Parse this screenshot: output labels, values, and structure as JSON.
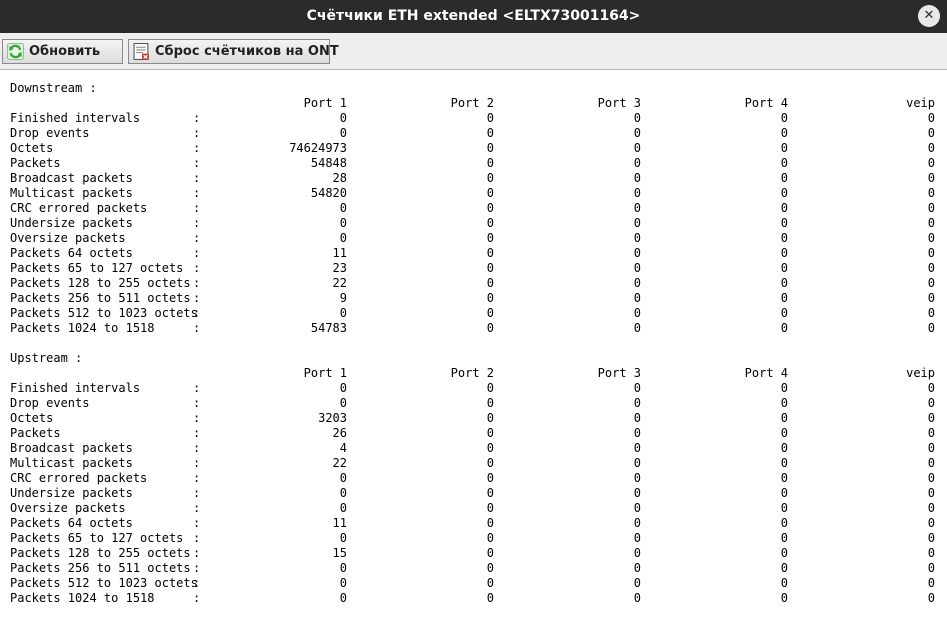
{
  "window": {
    "title": "Счётчики ETH extended <ELTX73001164>",
    "close_glyph": "✕"
  },
  "toolbar": {
    "refresh_label": "Обновить",
    "refresh_icon": "refresh-icon",
    "reset_label": "Сброс счётчиков на ONT",
    "reset_icon": "reset-counters-icon"
  },
  "colors": {
    "titlebar": "#2b2b2b",
    "toolbar": "#eeeeee",
    "refresh_icon_green": "#3aa53a",
    "reset_icon_red": "#d03030"
  },
  "columns": [
    "Port 1",
    "Port 2",
    "Port 3",
    "Port 4",
    "veip"
  ],
  "downstream": {
    "title": "Downstream :",
    "rows": [
      {
        "label": "Finished intervals",
        "values": [
          "0",
          "0",
          "0",
          "0",
          "0"
        ]
      },
      {
        "label": "Drop events",
        "values": [
          "0",
          "0",
          "0",
          "0",
          "0"
        ]
      },
      {
        "label": "Octets",
        "values": [
          "74624973",
          "0",
          "0",
          "0",
          "0"
        ]
      },
      {
        "label": "Packets",
        "values": [
          "54848",
          "0",
          "0",
          "0",
          "0"
        ]
      },
      {
        "label": "Broadcast packets",
        "values": [
          "28",
          "0",
          "0",
          "0",
          "0"
        ]
      },
      {
        "label": "Multicast packets",
        "values": [
          "54820",
          "0",
          "0",
          "0",
          "0"
        ]
      },
      {
        "label": "CRC errored packets",
        "values": [
          "0",
          "0",
          "0",
          "0",
          "0"
        ]
      },
      {
        "label": "Undersize packets",
        "values": [
          "0",
          "0",
          "0",
          "0",
          "0"
        ]
      },
      {
        "label": "Oversize packets",
        "values": [
          "0",
          "0",
          "0",
          "0",
          "0"
        ]
      },
      {
        "label": "Packets 64 octets",
        "values": [
          "11",
          "0",
          "0",
          "0",
          "0"
        ]
      },
      {
        "label": "Packets 65 to 127 octets",
        "values": [
          "23",
          "0",
          "0",
          "0",
          "0"
        ]
      },
      {
        "label": "Packets 128 to 255 octets",
        "values": [
          "22",
          "0",
          "0",
          "0",
          "0"
        ]
      },
      {
        "label": "Packets 256 to 511 octets",
        "values": [
          "9",
          "0",
          "0",
          "0",
          "0"
        ]
      },
      {
        "label": "Packets 512 to 1023 octets",
        "values": [
          "0",
          "0",
          "0",
          "0",
          "0"
        ]
      },
      {
        "label": "Packets 1024 to 1518",
        "values": [
          "54783",
          "0",
          "0",
          "0",
          "0"
        ]
      }
    ]
  },
  "upstream": {
    "title": "Upstream :",
    "rows": [
      {
        "label": "Finished intervals",
        "values": [
          "0",
          "0",
          "0",
          "0",
          "0"
        ]
      },
      {
        "label": "Drop events",
        "values": [
          "0",
          "0",
          "0",
          "0",
          "0"
        ]
      },
      {
        "label": "Octets",
        "values": [
          "3203",
          "0",
          "0",
          "0",
          "0"
        ]
      },
      {
        "label": "Packets",
        "values": [
          "26",
          "0",
          "0",
          "0",
          "0"
        ]
      },
      {
        "label": "Broadcast packets",
        "values": [
          "4",
          "0",
          "0",
          "0",
          "0"
        ]
      },
      {
        "label": "Multicast packets",
        "values": [
          "22",
          "0",
          "0",
          "0",
          "0"
        ]
      },
      {
        "label": "CRC errored packets",
        "values": [
          "0",
          "0",
          "0",
          "0",
          "0"
        ]
      },
      {
        "label": "Undersize packets",
        "values": [
          "0",
          "0",
          "0",
          "0",
          "0"
        ]
      },
      {
        "label": "Oversize packets",
        "values": [
          "0",
          "0",
          "0",
          "0",
          "0"
        ]
      },
      {
        "label": "Packets 64 octets",
        "values": [
          "11",
          "0",
          "0",
          "0",
          "0"
        ]
      },
      {
        "label": "Packets 65 to 127 octets",
        "values": [
          "0",
          "0",
          "0",
          "0",
          "0"
        ]
      },
      {
        "label": "Packets 128 to 255 octets",
        "values": [
          "15",
          "0",
          "0",
          "0",
          "0"
        ]
      },
      {
        "label": "Packets 256 to 511 octets",
        "values": [
          "0",
          "0",
          "0",
          "0",
          "0"
        ]
      },
      {
        "label": "Packets 512 to 1023 octets",
        "values": [
          "0",
          "0",
          "0",
          "0",
          "0"
        ]
      },
      {
        "label": "Packets 1024 to 1518",
        "values": [
          "0",
          "0",
          "0",
          "0",
          "0"
        ]
      }
    ]
  }
}
